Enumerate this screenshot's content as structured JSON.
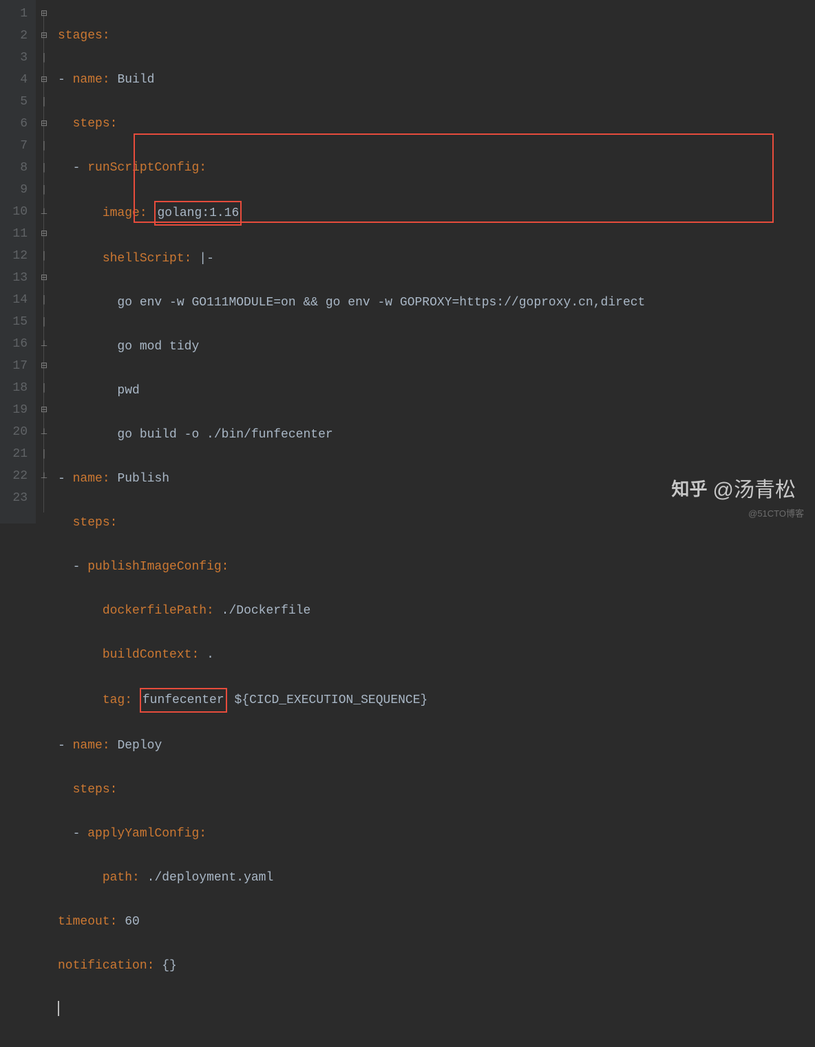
{
  "lines": {
    "l1": {
      "num": "1",
      "k": "stages",
      "v": "",
      "indent": 0
    },
    "l2": {
      "num": "2",
      "k": "name",
      "v": "Build",
      "prefix": "- ",
      "indent": 0
    },
    "l3": {
      "num": "3",
      "k": "steps",
      "v": "",
      "indent": 1
    },
    "l4": {
      "num": "4",
      "k": "runScriptConfig",
      "v": "",
      "prefix": "- ",
      "indent": 1
    },
    "l5": {
      "num": "5",
      "k": "image",
      "v": "golang:1.16",
      "indent": 3,
      "boxval": true
    },
    "l6": {
      "num": "6",
      "k": "shellScript",
      "v": "|-",
      "indent": 3
    },
    "l7": {
      "num": "7",
      "shell": "go env -w GO111MODULE=on && go env -w GOPROXY=https://goproxy.cn,direct",
      "indent": 4
    },
    "l8": {
      "num": "8",
      "shell": "go mod tidy",
      "indent": 4
    },
    "l9": {
      "num": "9",
      "shell": "pwd",
      "indent": 4
    },
    "l10": {
      "num": "10",
      "shell": "go build -o ./bin/funfecenter",
      "indent": 4
    },
    "l11": {
      "num": "11",
      "k": "name",
      "v": "Publish",
      "prefix": "- ",
      "indent": 0
    },
    "l12": {
      "num": "12",
      "k": "steps",
      "v": "",
      "indent": 1
    },
    "l13": {
      "num": "13",
      "k": "publishImageConfig",
      "v": "",
      "prefix": "- ",
      "indent": 1
    },
    "l14": {
      "num": "14",
      "k": "dockerfilePath",
      "v": "./Dockerfile",
      "indent": 3
    },
    "l15": {
      "num": "15",
      "k": "buildContext",
      "v": ".",
      "indent": 3
    },
    "l16": {
      "num": "16",
      "k": "tag",
      "v": "funfecenter",
      "suffix": "${CICD_EXECUTION_SEQUENCE}",
      "indent": 3,
      "boxval": true
    },
    "l17": {
      "num": "17",
      "k": "name",
      "v": "Deploy",
      "prefix": "- ",
      "indent": 0
    },
    "l18": {
      "num": "18",
      "k": "steps",
      "v": "",
      "indent": 1
    },
    "l19": {
      "num": "19",
      "k": "applyYamlConfig",
      "v": "",
      "prefix": "- ",
      "indent": 1
    },
    "l20": {
      "num": "20",
      "k": "path",
      "v": "./deployment.yaml",
      "indent": 3
    },
    "l21": {
      "num": "21",
      "k": "timeout",
      "v": "60",
      "indent": 0
    },
    "l22": {
      "num": "22",
      "k": "notification",
      "v": "{}",
      "indent": 0
    },
    "l23": {
      "num": "23",
      "cursor": true
    }
  },
  "watermark": {
    "zhihu": "知乎",
    "author": "@汤青松",
    "cto": "@51CTO博客"
  }
}
